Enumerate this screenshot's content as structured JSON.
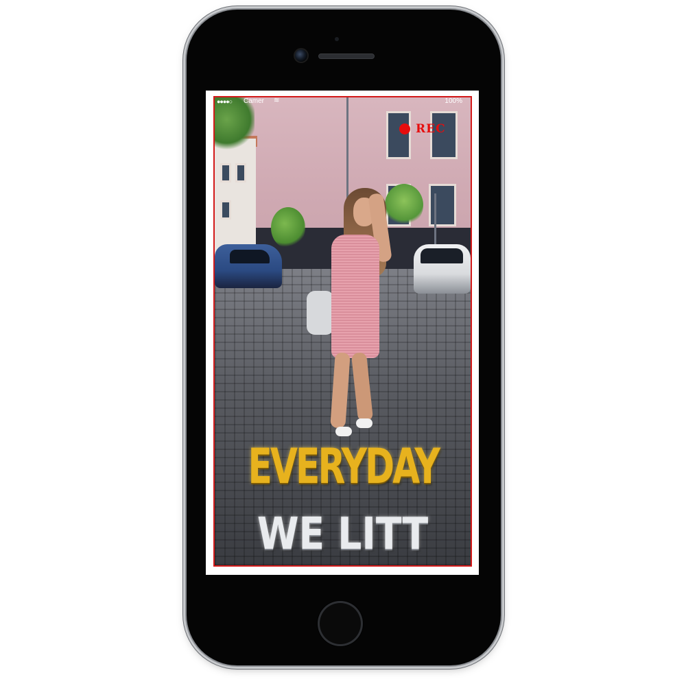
{
  "status_bar": {
    "signal": "●●●●○",
    "carrier": "Camer",
    "wifi": "≋",
    "battery": "100%"
  },
  "overlay": {
    "rec_label": "REC",
    "headline_line1": "EVERYDAY",
    "headline_line2": "WE LITT"
  },
  "colors": {
    "rec_red": "#e60d0d",
    "frame_border": "#d31919",
    "headline_gold": "#e7b21e",
    "headline_silver": "#e9ebee"
  }
}
